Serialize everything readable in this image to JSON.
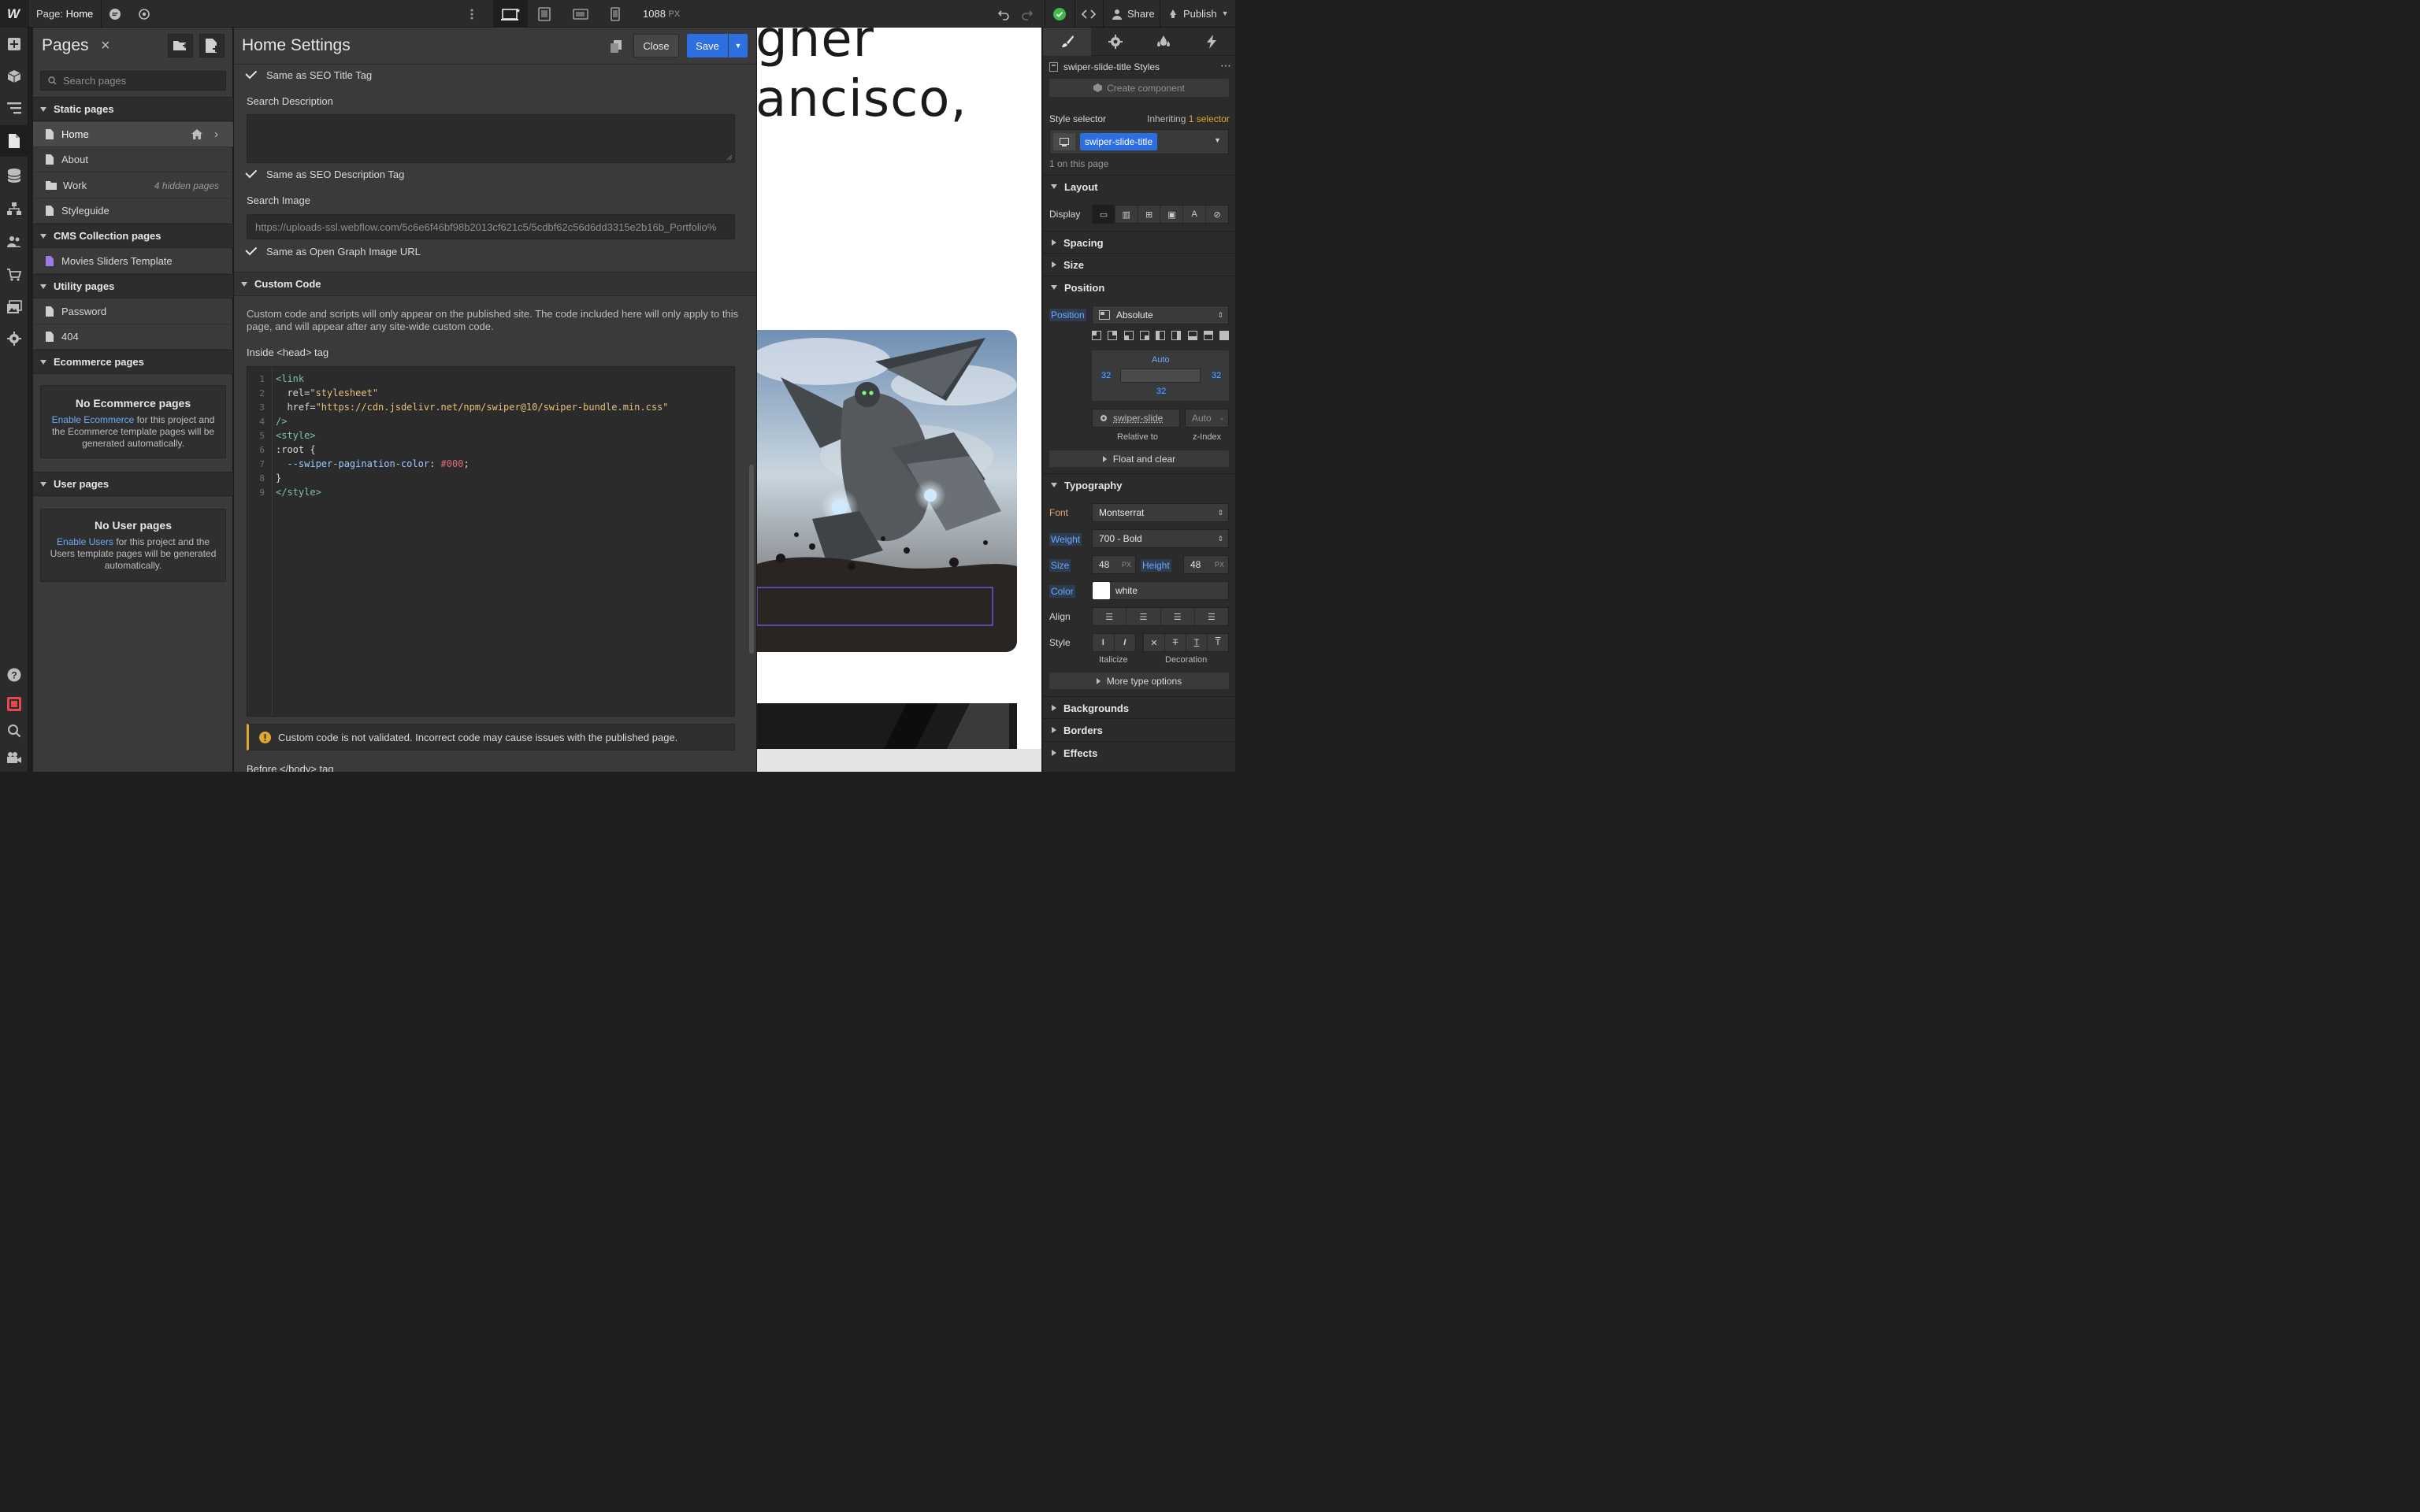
{
  "topbar": {
    "page_prefix": "Page:",
    "page_name": "Home",
    "width_value": "1088",
    "width_unit": "PX",
    "share": "Share",
    "publish": "Publish"
  },
  "pages_panel": {
    "title": "Pages",
    "search_placeholder": "Search pages",
    "sections": {
      "static": "Static pages",
      "cms": "CMS Collection pages",
      "utility": "Utility pages",
      "ecommerce": "Ecommerce pages",
      "user": "User pages"
    },
    "static_pages": [
      "Home",
      "About",
      "Work",
      "Styleguide"
    ],
    "work_hidden": "4 hidden pages",
    "cms_pages": [
      "Movies Sliders Template"
    ],
    "utility_pages": [
      "Password",
      "404"
    ],
    "ecommerce_empty": {
      "title": "No Ecommerce pages",
      "link": "Enable Ecommerce",
      "text": "for this project and the Ecommerce template pages will be generated automatically."
    },
    "user_empty": {
      "title": "No User pages",
      "link": "Enable Users",
      "text": "for this project and the Users template pages will be generated automatically."
    }
  },
  "settings": {
    "title": "Home Settings",
    "close": "Close",
    "save": "Save",
    "same_seo_title": "Same as SEO Title Tag",
    "search_description_label": "Search Description",
    "same_seo_desc": "Same as SEO Description Tag",
    "search_image_label": "Search Image",
    "search_image_url": "https://uploads-ssl.webflow.com/5c6e6f46bf98b2013cf621c5/5cdbf62c56d6dd3315e2b16b_Portfolio%",
    "same_og_image": "Same as Open Graph Image URL",
    "custom_code_header": "Custom Code",
    "custom_code_info": "Custom code and scripts will only appear on the published site. The code included here will only apply to this page, and will appear after any site-wide custom code.",
    "head_tag_label": "Inside <head> tag",
    "code_lines": [
      "1",
      "2",
      "3",
      "4",
      "5",
      "6",
      "7",
      "8",
      "9"
    ],
    "code": {
      "l1": "<link",
      "l2a": "  rel=",
      "l2b": "\"stylesheet\"",
      "l3a": "  href=",
      "l3b": "\"https://cdn.jsdelivr.net/npm/swiper@10/swiper-bundle.min.css\"",
      "l4": "/>",
      "l5": "<style>",
      "l6": ":root {",
      "l7a": "  --swiper-pagination-color",
      "l7b": ": ",
      "l7c": "#000",
      "l7d": ";",
      "l8": "}",
      "l9": "</style>"
    },
    "warning": "Custom code is not validated. Incorrect code may cause issues with the published page.",
    "before_body": "Before </body> tag"
  },
  "canvas": {
    "heading_line1": "gner",
    "heading_line2": "ancisco,"
  },
  "style_panel": {
    "styles_title": "swiper-slide-title Styles",
    "create_component": "Create component",
    "style_selector": "Style selector",
    "inheriting": "Inheriting",
    "inheriting_count": "1 selector",
    "selector_tag": "swiper-slide-title",
    "on_page": "1 on this page",
    "layout": "Layout",
    "display": "Display",
    "spacing": "Spacing",
    "size": "Size",
    "position_section": "Position",
    "position_label": "Position",
    "position_value": "Absolute",
    "pos_auto": "Auto",
    "pos_left": "32",
    "pos_right": "32",
    "pos_bottom": "32",
    "relative_el": "swiper-slide",
    "z_auto": "Auto",
    "z_dash": "-",
    "relative_to": "Relative to",
    "z_index": "z-Index",
    "float_clear": "Float and clear",
    "typography": "Typography",
    "font_label": "Font",
    "font_value": "Montserrat",
    "weight_label": "Weight",
    "weight_value": "700 - Bold",
    "size_label": "Size",
    "size_value": "48",
    "size_unit": "PX",
    "height_label": "Height",
    "height_value": "48",
    "height_unit": "PX",
    "color_label": "Color",
    "color_value": "white",
    "align_label": "Align",
    "style_label": "Style",
    "italicize": "Italicize",
    "decoration": "Decoration",
    "more_type": "More type options",
    "backgrounds": "Backgrounds",
    "borders": "Borders",
    "effects": "Effects"
  },
  "colors": {
    "accent": "#2d6ee0",
    "link": "#6ea9f7",
    "orange": "#e3a46f",
    "success": "#3fb950"
  }
}
